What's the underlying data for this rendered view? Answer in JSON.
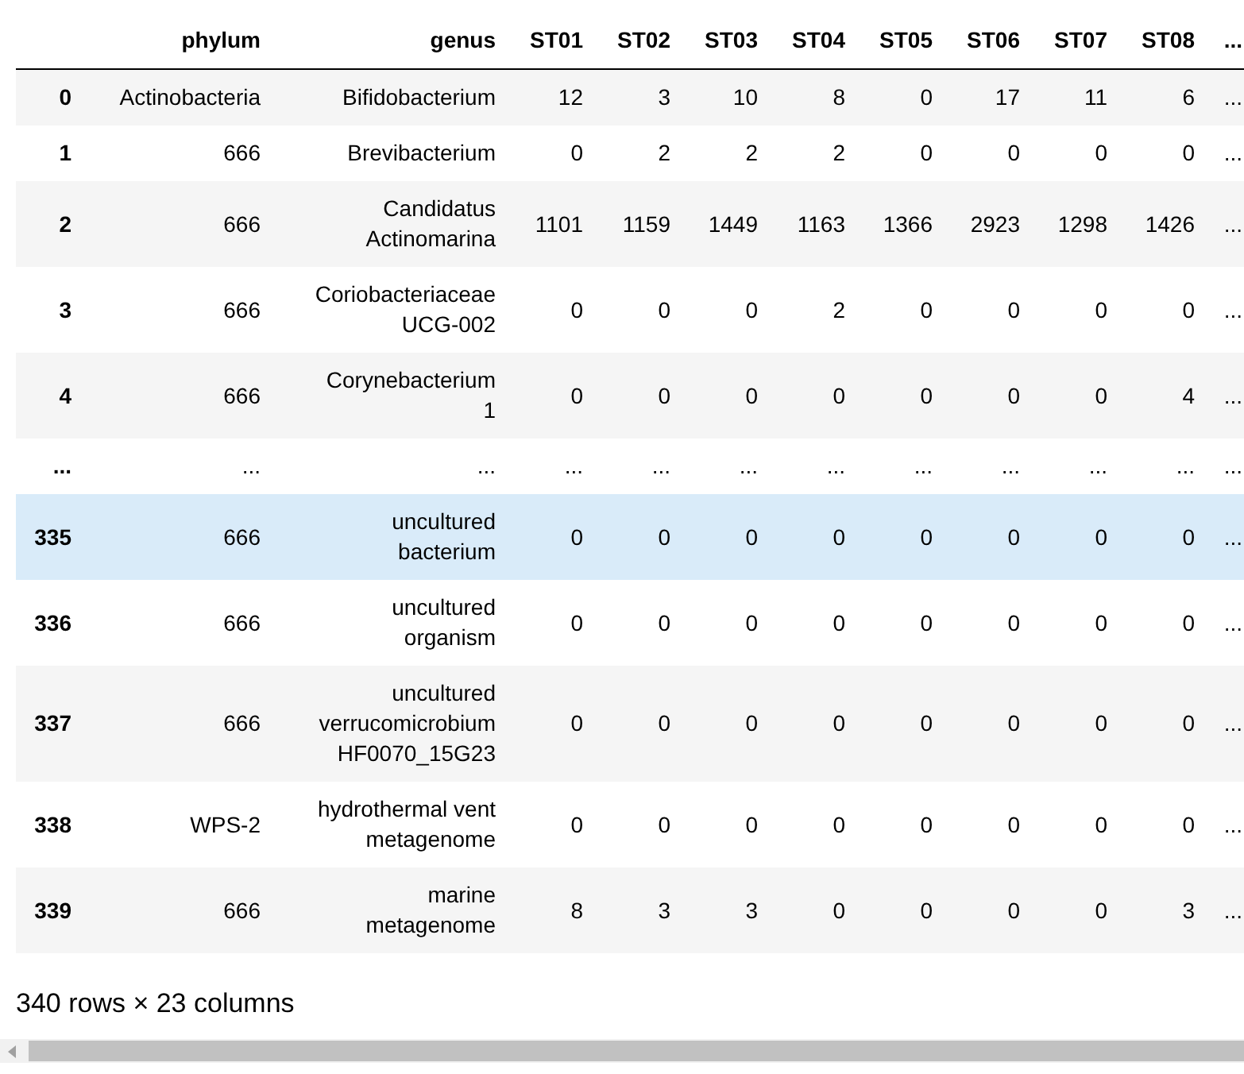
{
  "table": {
    "columns": [
      "phylum",
      "genus",
      "ST01",
      "ST02",
      "ST03",
      "ST04",
      "ST05",
      "ST06",
      "ST07",
      "ST08",
      "..."
    ],
    "rows": [
      {
        "index": "0",
        "cells": [
          "Actinobacteria",
          "Bifidobacterium",
          "12",
          "3",
          "10",
          "8",
          "0",
          "17",
          "11",
          "6",
          "..."
        ],
        "highlighted": false
      },
      {
        "index": "1",
        "cells": [
          "666",
          "Brevibacterium",
          "0",
          "2",
          "2",
          "2",
          "0",
          "0",
          "0",
          "0",
          "..."
        ],
        "highlighted": false
      },
      {
        "index": "2",
        "cells": [
          "666",
          "Candidatus\nActinomarina",
          "1101",
          "1159",
          "1449",
          "1163",
          "1366",
          "2923",
          "1298",
          "1426",
          "..."
        ],
        "highlighted": false
      },
      {
        "index": "3",
        "cells": [
          "666",
          "Coriobacteriaceae\nUCG-002",
          "0",
          "0",
          "0",
          "2",
          "0",
          "0",
          "0",
          "0",
          "..."
        ],
        "highlighted": false
      },
      {
        "index": "4",
        "cells": [
          "666",
          "Corynebacterium\n1",
          "0",
          "0",
          "0",
          "0",
          "0",
          "0",
          "0",
          "4",
          "..."
        ],
        "highlighted": false
      },
      {
        "index": "...",
        "cells": [
          "...",
          "...",
          "...",
          "...",
          "...",
          "...",
          "...",
          "...",
          "...",
          "...",
          "..."
        ],
        "highlighted": false
      },
      {
        "index": "335",
        "cells": [
          "666",
          "uncultured\nbacterium",
          "0",
          "0",
          "0",
          "0",
          "0",
          "0",
          "0",
          "0",
          "..."
        ],
        "highlighted": true
      },
      {
        "index": "336",
        "cells": [
          "666",
          "uncultured\norganism",
          "0",
          "0",
          "0",
          "0",
          "0",
          "0",
          "0",
          "0",
          "..."
        ],
        "highlighted": false
      },
      {
        "index": "337",
        "cells": [
          "666",
          "uncultured\nverrucomicrobium\nHF0070_15G23",
          "0",
          "0",
          "0",
          "0",
          "0",
          "0",
          "0",
          "0",
          "..."
        ],
        "highlighted": false
      },
      {
        "index": "338",
        "cells": [
          "WPS-2",
          "hydrothermal vent\nmetagenome",
          "0",
          "0",
          "0",
          "0",
          "0",
          "0",
          "0",
          "0",
          "..."
        ],
        "highlighted": false
      },
      {
        "index": "339",
        "cells": [
          "666",
          "marine\nmetagenome",
          "8",
          "3",
          "3",
          "0",
          "0",
          "0",
          "0",
          "3",
          "..."
        ],
        "highlighted": false
      }
    ]
  },
  "summary": "340 rows × 23 columns"
}
